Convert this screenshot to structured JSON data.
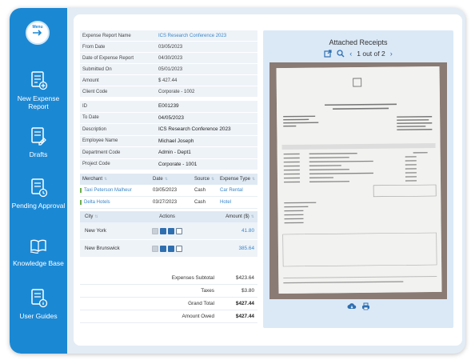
{
  "sidebar": {
    "menu_label": "Menu",
    "items": [
      {
        "label": "New Expense Report",
        "icon": "new-report-icon"
      },
      {
        "label": "Drafts",
        "icon": "drafts-icon"
      },
      {
        "label": "Pending Approval",
        "icon": "pending-approval-icon"
      },
      {
        "label": "Knowledge Base",
        "icon": "knowledge-base-icon"
      },
      {
        "label": "User Guides",
        "icon": "user-guides-icon"
      }
    ]
  },
  "report": {
    "fields": [
      {
        "key": "Expense Report Name",
        "value": "ICS Research Conference 2023"
      },
      {
        "key": "From Date",
        "value": "03/05/2023"
      },
      {
        "key": "Date of Expense Report",
        "value": "04/30/2023"
      },
      {
        "key": "Submitted On",
        "value": "05/01/2023"
      },
      {
        "key": "Amount",
        "value": "$ 427.44"
      },
      {
        "key": "Client Code",
        "value": "Corporate - 1002"
      }
    ],
    "details": [
      {
        "key": "ID",
        "value": "E001239"
      },
      {
        "key": "To Date",
        "value": "04/05/2023"
      },
      {
        "key": "Description",
        "value": "ICS Research Conference 2023"
      },
      {
        "key": "Employee Name",
        "value": "Michael Joseph"
      },
      {
        "key": "Department Code",
        "value": "Admin - Dept1"
      },
      {
        "key": "Project Code",
        "value": "Corporate - 1001"
      }
    ]
  },
  "expenses": {
    "headers": {
      "merchant": "Merchant",
      "date": "Date",
      "source": "Source",
      "type": "Expense Type"
    },
    "rows": [
      {
        "merchant": "Taxi Peterson Malheur",
        "date": "03/05/2023",
        "source": "Cash",
        "type": "Car Rental"
      },
      {
        "merchant": "Delta Hotels",
        "date": "03/27/2023",
        "source": "Cash",
        "type": "Hotel"
      }
    ]
  },
  "cities": {
    "headers": {
      "city": "City",
      "actions": "Actions",
      "amount": "Amount ($)"
    },
    "rows": [
      {
        "city": "New York",
        "amount": "41.80"
      },
      {
        "city": "New Brunswick",
        "amount": "385.64"
      }
    ]
  },
  "totals": [
    {
      "label": "Expenses Subtotal",
      "value": "$423.64"
    },
    {
      "label": "Taxes",
      "value": "$3.80"
    },
    {
      "label": "Grand Total",
      "value": "$427.44"
    },
    {
      "label": "Amount Owed",
      "value": "$427.44"
    }
  ],
  "receipts": {
    "title": "Attached Receipts",
    "pager": "1 out of 2"
  },
  "colors": {
    "sidebar": "#1b88d4",
    "accent": "#3a86c8",
    "panel": "#dbe9f7"
  }
}
